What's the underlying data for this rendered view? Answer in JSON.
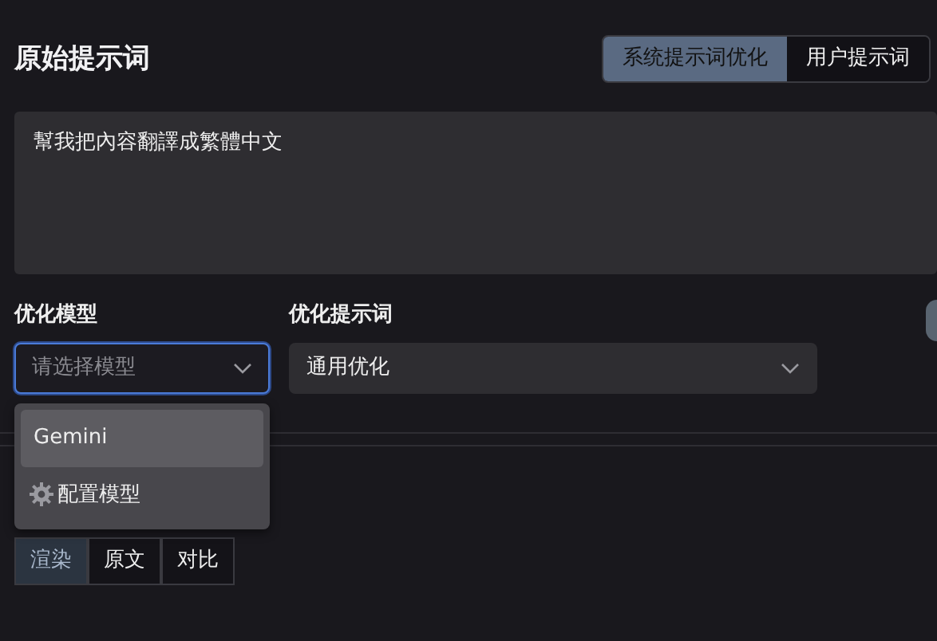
{
  "title": "原始提示词",
  "tabs": [
    {
      "label": "系统提示词优化",
      "selected": true
    },
    {
      "label": "用户提示词",
      "selected": false
    }
  ],
  "prompt_text": "幫我把內容翻譯成繁體中文",
  "model_select": {
    "label": "优化模型",
    "placeholder": "请选择模型",
    "focused": true,
    "expanded": true,
    "options": [
      {
        "kind": "option",
        "label": "Gemini",
        "selected": true
      },
      {
        "kind": "action",
        "label": "配置模型",
        "selected": false
      }
    ]
  },
  "template_select": {
    "label": "优化提示词",
    "value": "通用优化"
  },
  "view_modes": [
    {
      "label": "渲染",
      "selected": true
    },
    {
      "label": "原文",
      "selected": false
    },
    {
      "label": "对比",
      "selected": false
    }
  ]
}
